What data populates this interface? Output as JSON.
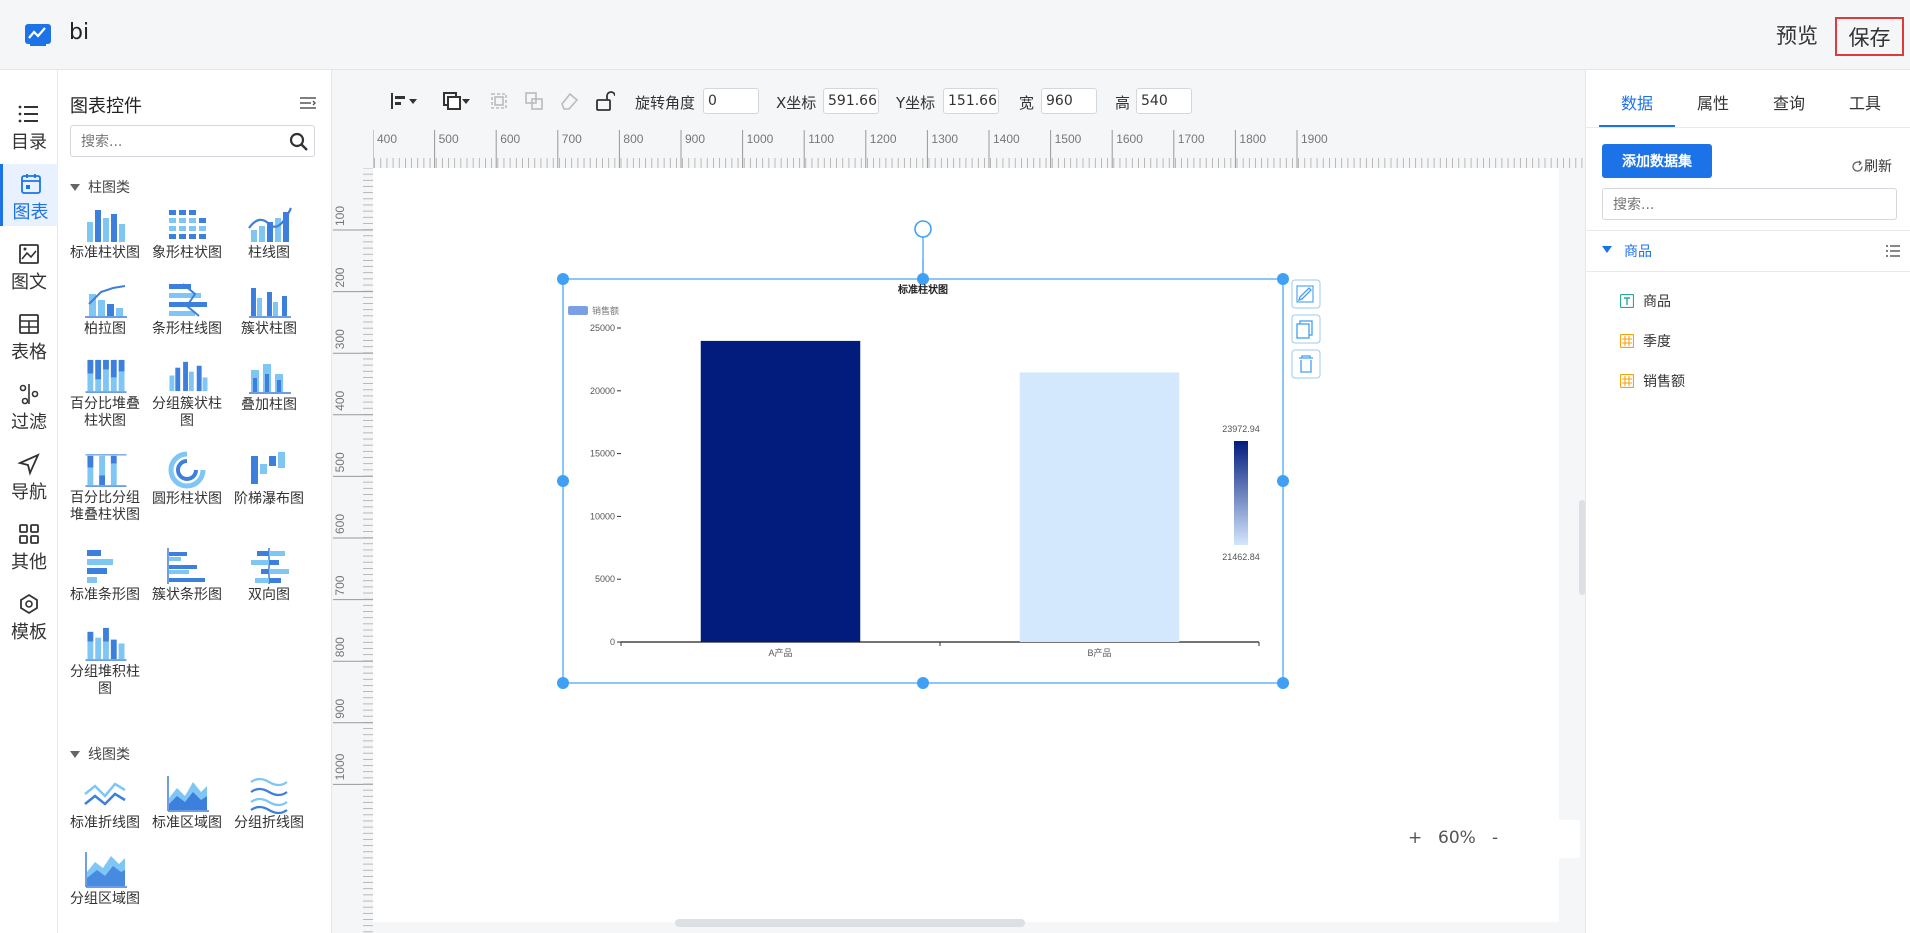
{
  "app": {
    "title": "bi",
    "preview_label": "预览",
    "save_label": "保存"
  },
  "nav": {
    "items": [
      {
        "label": "目录",
        "icon": "list-icon"
      },
      {
        "label": "图表",
        "icon": "chart-icon",
        "active": true
      },
      {
        "label": "图文",
        "icon": "image-text-icon"
      },
      {
        "label": "表格",
        "icon": "table-icon"
      },
      {
        "label": "过滤",
        "icon": "filter-icon"
      },
      {
        "label": "导航",
        "icon": "navigation-icon"
      },
      {
        "label": "其他",
        "icon": "grid-icon"
      },
      {
        "label": "模板",
        "icon": "template-icon"
      }
    ]
  },
  "components": {
    "title": "图表控件",
    "search_placeholder": "搜索...",
    "sections": [
      {
        "title": "柱图类",
        "items": [
          "标准柱状图",
          "象形柱状图",
          "柱线图",
          "柏拉图",
          "条形柱线图",
          "簇状柱图",
          "百分比堆叠柱状图",
          "分组簇状柱图",
          "叠加柱图",
          "百分比分组堆叠柱状图",
          "圆形柱状图",
          "阶梯瀑布图",
          "标准条形图",
          "簇状条形图",
          "双向图",
          "分组堆积柱图"
        ]
      },
      {
        "title": "线图类",
        "items": [
          "标准折线图",
          "标准区域图",
          "分组折线图",
          "分组区域图"
        ]
      }
    ]
  },
  "toolbar": {
    "rotate_label": "旋转角度",
    "rotate_value": "0",
    "x_label": "X坐标",
    "x_value": "591.666",
    "y_label": "Y坐标",
    "y_value": "151.666",
    "w_label": "宽",
    "w_value": "960",
    "h_label": "高",
    "h_value": "540"
  },
  "ruler": {
    "h_ticks": [
      "400",
      "500",
      "600",
      "700",
      "800",
      "900",
      "1000",
      "1100",
      "1200",
      "1300",
      "1400",
      "1500",
      "1600",
      "1700",
      "1800",
      "1900"
    ],
    "v_ticks": [
      "100",
      "200",
      "300",
      "400",
      "500",
      "600",
      "700",
      "800",
      "900",
      "1000"
    ]
  },
  "zoom": {
    "plus": "+",
    "value": "60%",
    "minus": "-"
  },
  "chart_data": {
    "type": "bar",
    "title": "标准柱状图",
    "legend": [
      "销售额"
    ],
    "categories": [
      "A产品",
      "B产品"
    ],
    "values": [
      23972.94,
      21462.84
    ],
    "ylim": [
      0,
      25000
    ],
    "yticks": [
      "0",
      "5000",
      "10000",
      "15000",
      "20000",
      "25000"
    ],
    "visual_map": {
      "max_label": "23972.94",
      "min_label": "21462.84",
      "max_color": "#011c7d",
      "min_color": "#d3e7fd"
    },
    "legend_position": "top-left"
  },
  "right": {
    "tabs": [
      "数据",
      "属性",
      "查询",
      "工具"
    ],
    "add_dataset_label": "添加数据集",
    "refresh_label": "刷新",
    "search_placeholder": "搜索...",
    "dataset_name": "商品",
    "fields": [
      {
        "name": "商品",
        "type": "text"
      },
      {
        "name": "季度",
        "type": "dimension"
      },
      {
        "name": "销售额",
        "type": "dimension"
      }
    ]
  },
  "colors": {
    "accent": "#1c73e8",
    "bar_dark": "#011c7d",
    "bar_light": "#d3e7fd",
    "selection": "#3fa0f5"
  }
}
